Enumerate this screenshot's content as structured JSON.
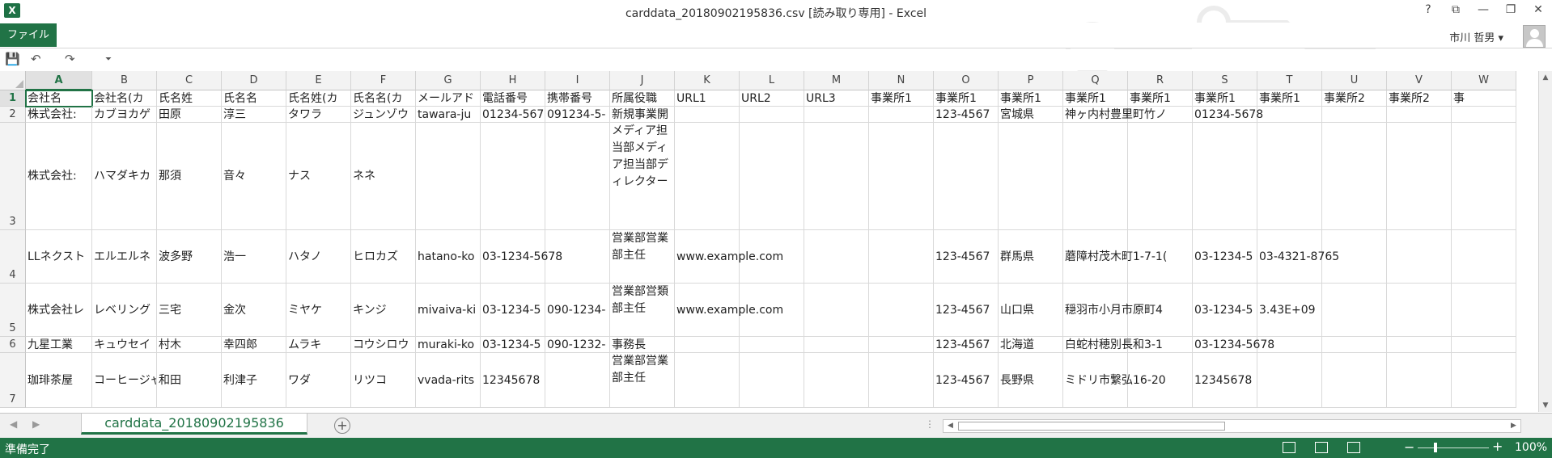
{
  "app": {
    "icon": "excel-icon",
    "title": "carddata_20180902195836.csv  [読み取り専用] - Excel",
    "controls": [
      "?",
      "⧉",
      "—",
      "❐",
      "✕"
    ]
  },
  "ribbon": {
    "file_tab": "ファイル",
    "user": "市川 哲男 ▾"
  },
  "qat": {
    "save": "💾",
    "undo": "↶",
    "redo": "↷",
    "customize": "⏷"
  },
  "columns": [
    "A",
    "B",
    "C",
    "D",
    "E",
    "F",
    "G",
    "H",
    "I",
    "J",
    "K",
    "L",
    "M",
    "N",
    "O",
    "P",
    "Q",
    "R",
    "S",
    "T",
    "U",
    "V",
    "W"
  ],
  "rows": [
    {
      "num": "1",
      "cells": [
        "会社名",
        "会社名(カ",
        "氏名姓",
        "氏名名",
        "氏名姓(カ",
        "氏名名(カ",
        "メールアド",
        "電話番号",
        "携帯番号",
        "所属役職",
        "URL1",
        "URL2",
        "URL3",
        "事業所1",
        "事業所1",
        "事業所1",
        "事業所1",
        "事業所1",
        "事業所1",
        "事業所1",
        "事業所2",
        "事業所2",
        "事"
      ]
    },
    {
      "num": "2",
      "cells": [
        "株式会社:",
        "カブヨカゲ",
        "田原",
        "淳三",
        "タワラ",
        "ジュンゾウ",
        "tawara-ju",
        "01234-567",
        "091234-5-",
        "新規事業開発部　課長",
        "",
        "",
        "",
        "",
        "123-4567",
        "宮城県",
        "神ヶ内村豊里町竹ノ",
        "",
        "01234-5678",
        "",
        "",
        "",
        ""
      ]
    },
    {
      "num": "3",
      "cells": [
        "株式会社:",
        "ハマダキカ",
        "那須",
        "音々",
        "ナス",
        "ネネ",
        "",
        "",
        "",
        "メディア担当部メディア担当部ディレクター",
        "",
        "",
        "",
        "",
        "",
        "",
        "",
        "",
        "",
        "",
        "",
        "",
        ""
      ]
    },
    {
      "num": "4",
      "cells": [
        "LLネクスト",
        "エルエルネ",
        "波多野",
        "浩一",
        "ハタノ",
        "ヒロカズ",
        "hatano-ko",
        "03-1234-5678",
        "",
        "営業部営業部主任",
        "www.example.com",
        "",
        "",
        "",
        "123-4567",
        "群馬県",
        "蘑障村茂木町1-7-1(",
        "",
        "03-1234-5",
        "03-4321-8765",
        "",
        "",
        ""
      ]
    },
    {
      "num": "5",
      "cells": [
        "株式会社レ",
        "レベリング",
        "三宅",
        "金次",
        "ミヤケ",
        "キンジ",
        "mivaiva-ki",
        "03-1234-5",
        "090-1234-",
        "営業部営類部主任",
        "www.example.com",
        "",
        "",
        "",
        "123-4567",
        "山口県",
        "穏羽市小月市原町4",
        "",
        "03-1234-5",
        "3.43E+09",
        "",
        "",
        ""
      ]
    },
    {
      "num": "6",
      "cells": [
        "九星工業",
        "キュウセイ",
        "村木",
        "幸四郎",
        "ムラキ",
        "コウシロウ",
        "muraki-ko",
        "03-1234-5",
        "090-1232-",
        "事務長",
        "",
        "",
        "",
        "",
        "123-4567",
        "北海道",
        "白蛇村穂別長和3-1",
        "",
        "03-1234-5678",
        "",
        "",
        "",
        ""
      ]
    },
    {
      "num": "7",
      "cells": [
        "珈琲茶屋",
        "コーヒージャ",
        "和田",
        "利津子",
        "ワダ",
        "リツコ",
        "vvada-rits",
        "12345678",
        "",
        "営業部営業部主任",
        "",
        "",
        "",
        "",
        "123-4567",
        "長野県",
        "ミドリ市繋弘16-20",
        "",
        "12345678",
        "",
        "",
        "",
        ""
      ]
    }
  ],
  "sheet_tab": "carddata_20180902195836",
  "add_sheet": "+",
  "status": {
    "text": "準備完了",
    "zoom": "100%",
    "minus": "−",
    "plus": "+"
  },
  "scroll": {
    "left": "◀",
    "right": "▶",
    "up": "▲",
    "down": "▼",
    "nav_prev": "◀",
    "nav_next": "▶",
    "dots": "⋮"
  }
}
